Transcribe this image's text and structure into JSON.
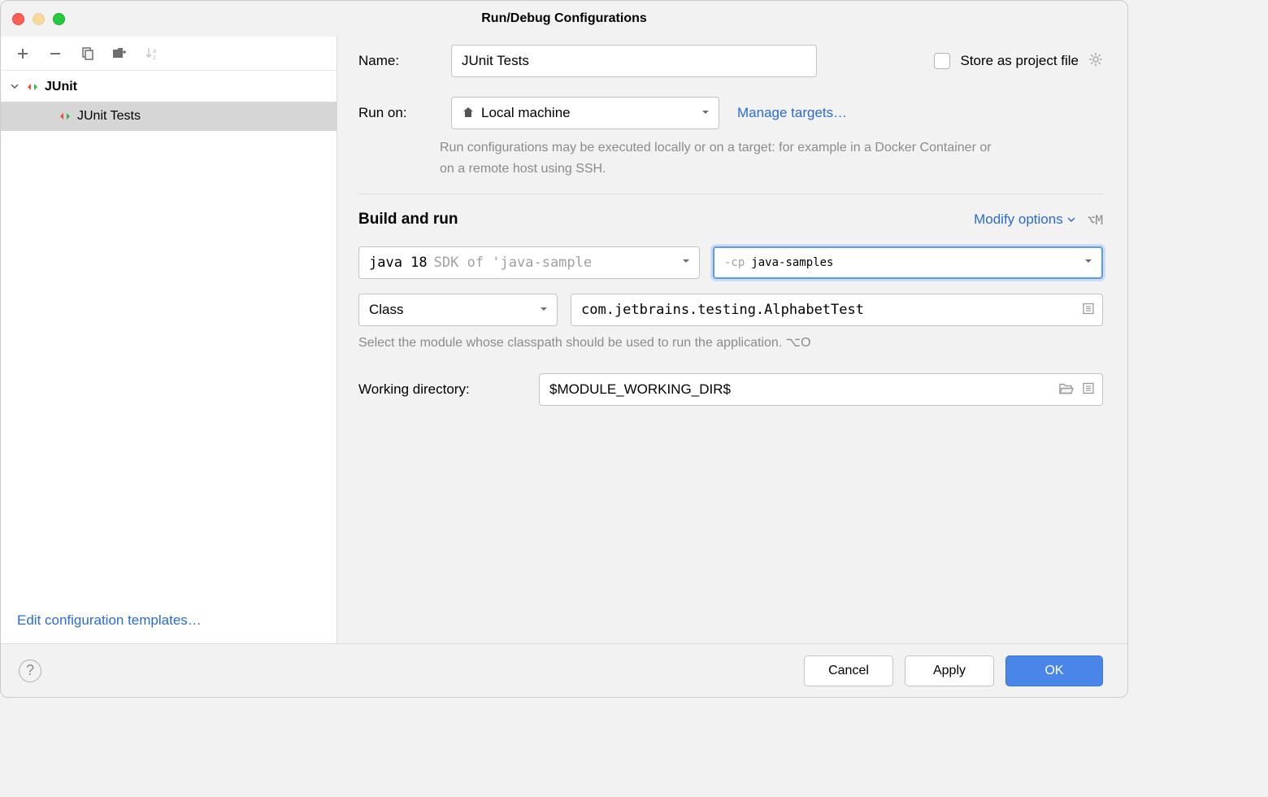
{
  "window": {
    "title": "Run/Debug Configurations"
  },
  "sidebar": {
    "group": "JUnit",
    "item": "JUnit Tests",
    "footer_link": "Edit configuration templates…"
  },
  "form": {
    "name_label": "Name:",
    "name_value": "JUnit Tests",
    "store_label": "Store as project file",
    "runon_label": "Run on:",
    "runon_value": "Local machine",
    "manage_targets": "Manage targets…",
    "runon_desc": "Run configurations may be executed locally or on a target: for example in a Docker Container or on a remote host using SSH.",
    "build_section_title": "Build and run",
    "modify_options": "Modify options",
    "modify_shortcut": "⌥M",
    "jdk_main": "java 18",
    "jdk_sub": "SDK of 'java-sample",
    "cp_flag": "-cp",
    "cp_value": "java-samples",
    "scope": "Class",
    "class_name": "com.jetbrains.testing.AlphabetTest",
    "module_hint": "Select the module whose classpath should be used to run the application. ⌥O",
    "wd_label": "Working directory:",
    "wd_value": "$MODULE_WORKING_DIR$"
  },
  "footer": {
    "cancel": "Cancel",
    "apply": "Apply",
    "ok": "OK"
  }
}
